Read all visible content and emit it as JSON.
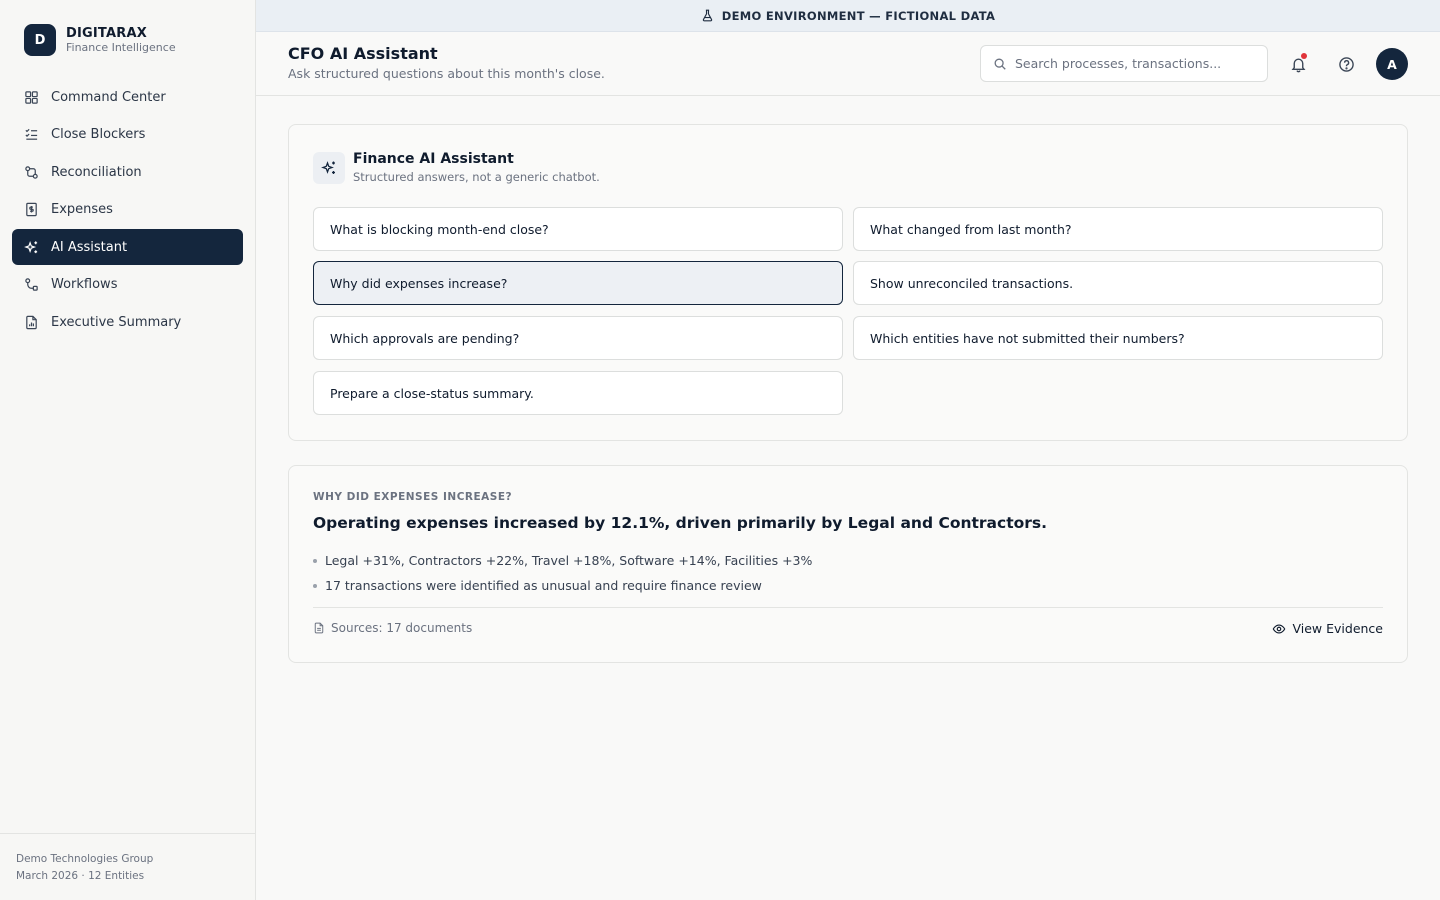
{
  "brand": {
    "logo_letter": "D",
    "name": "DIGITARAX",
    "subtitle": "Finance Intelligence"
  },
  "sidebar": {
    "items": [
      {
        "label": "Command Center",
        "icon": "grid-icon",
        "active": false
      },
      {
        "label": "Close Blockers",
        "icon": "checklist-icon",
        "active": false
      },
      {
        "label": "Reconciliation",
        "icon": "reconcile-icon",
        "active": false
      },
      {
        "label": "Expenses",
        "icon": "receipt-icon",
        "active": false
      },
      {
        "label": "AI Assistant",
        "icon": "sparkles-icon",
        "active": true
      },
      {
        "label": "Workflows",
        "icon": "workflow-icon",
        "active": false
      },
      {
        "label": "Executive Summary",
        "icon": "report-icon",
        "active": false
      }
    ],
    "footer": {
      "company": "Demo Technologies Group",
      "period": "March 2026 · 12 Entities"
    }
  },
  "banner": {
    "icon": "flask-icon",
    "text": "DEMO ENVIRONMENT — FICTIONAL DATA"
  },
  "header": {
    "title": "CFO AI Assistant",
    "subtitle": "Ask structured questions about this month's close.",
    "search_placeholder": "Search processes, transactions...",
    "avatar_letter": "A",
    "notification_dot": true
  },
  "assistant": {
    "title": "Finance AI Assistant",
    "subtitle": "Structured answers, not a generic chatbot.",
    "questions": [
      {
        "label": "What is blocking month-end close?",
        "selected": false
      },
      {
        "label": "What changed from last month?",
        "selected": false
      },
      {
        "label": "Why did expenses increase?",
        "selected": true
      },
      {
        "label": "Show unreconciled transactions.",
        "selected": false
      },
      {
        "label": "Which approvals are pending?",
        "selected": false
      },
      {
        "label": "Which entities have not submitted their numbers?",
        "selected": false
      },
      {
        "label": "Prepare a close-status summary.",
        "selected": false
      }
    ]
  },
  "answer": {
    "eyebrow": "WHY DID EXPENSES INCREASE?",
    "headline": "Operating expenses increased by 12.1%, driven primarily by Legal and Contractors.",
    "bullets": [
      "Legal +31%, Contractors +22%, Travel +18%, Software +14%, Facilities +3%",
      "17 transactions were identified as unusual and require finance review"
    ],
    "sources": "Sources: 17 documents",
    "view_evidence": "View Evidence"
  },
  "colors": {
    "navy": "#14263d",
    "notification": "#e0343a",
    "banner_bg": "#eaeff4"
  }
}
